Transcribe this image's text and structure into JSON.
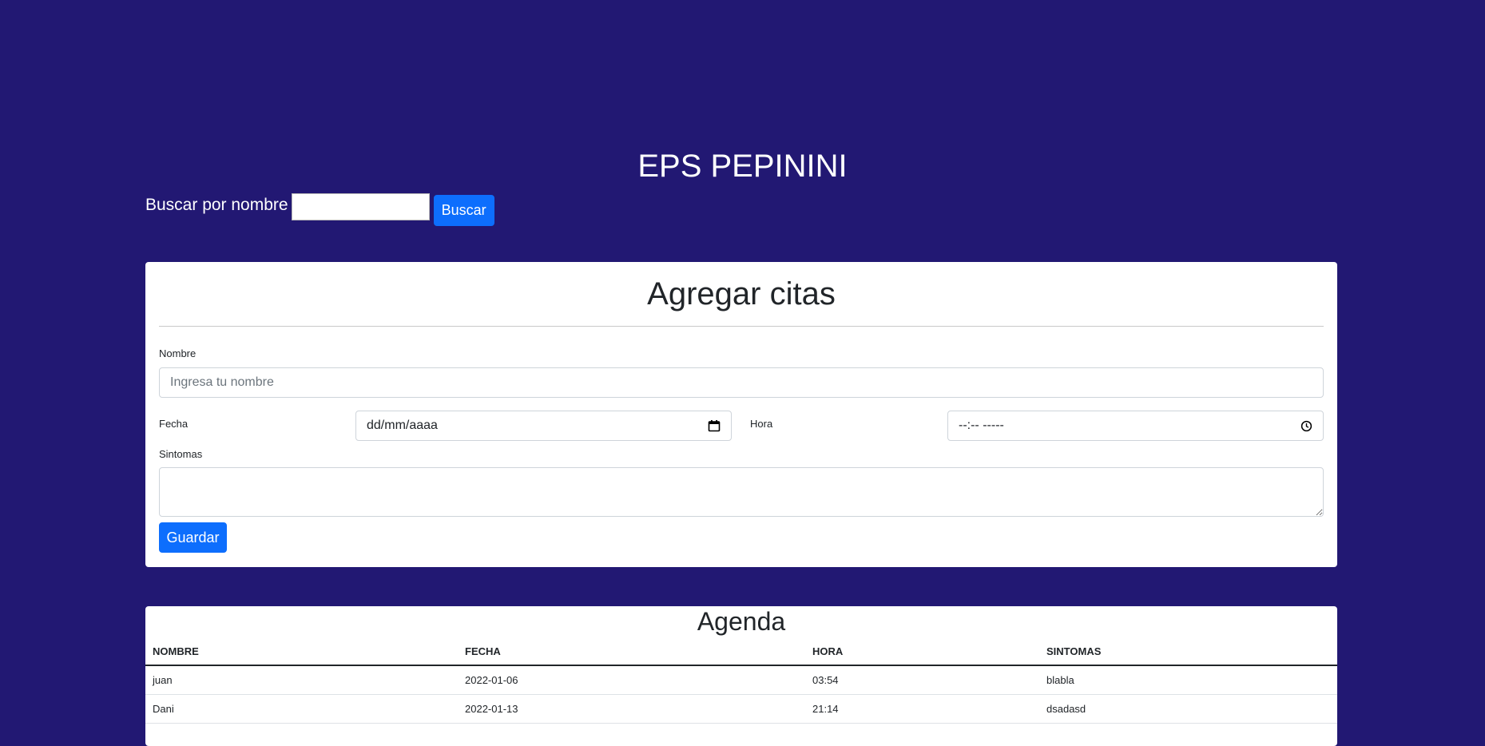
{
  "header": {
    "title": "EPS PEPININI"
  },
  "search": {
    "label": "Buscar por nombre",
    "value": "",
    "button_label": "Buscar"
  },
  "form": {
    "title": "Agregar citas",
    "nombre_label": "Nombre",
    "nombre_placeholder": "Ingresa tu nombre",
    "fecha_label": "Fecha",
    "fecha_placeholder": "dd/mm/aaaa",
    "hora_label": "Hora",
    "hora_placeholder": "--:-- -----",
    "sintomas_label": "Sintomas",
    "save_label": "Guardar"
  },
  "agenda": {
    "title": "Agenda",
    "columns": [
      "NOMBRE",
      "FECHA",
      "HORA",
      "SINTOMAS"
    ],
    "rows": [
      [
        "juan",
        "2022-01-06",
        "03:54",
        "blabla"
      ],
      [
        "Dani",
        "2022-01-13",
        "21:14",
        "dsadasd"
      ]
    ]
  },
  "colors": {
    "background": "#221873",
    "primary": "#0d6efd"
  },
  "icons": {
    "fecha": "calendar-icon",
    "hora": "clock-icon"
  }
}
